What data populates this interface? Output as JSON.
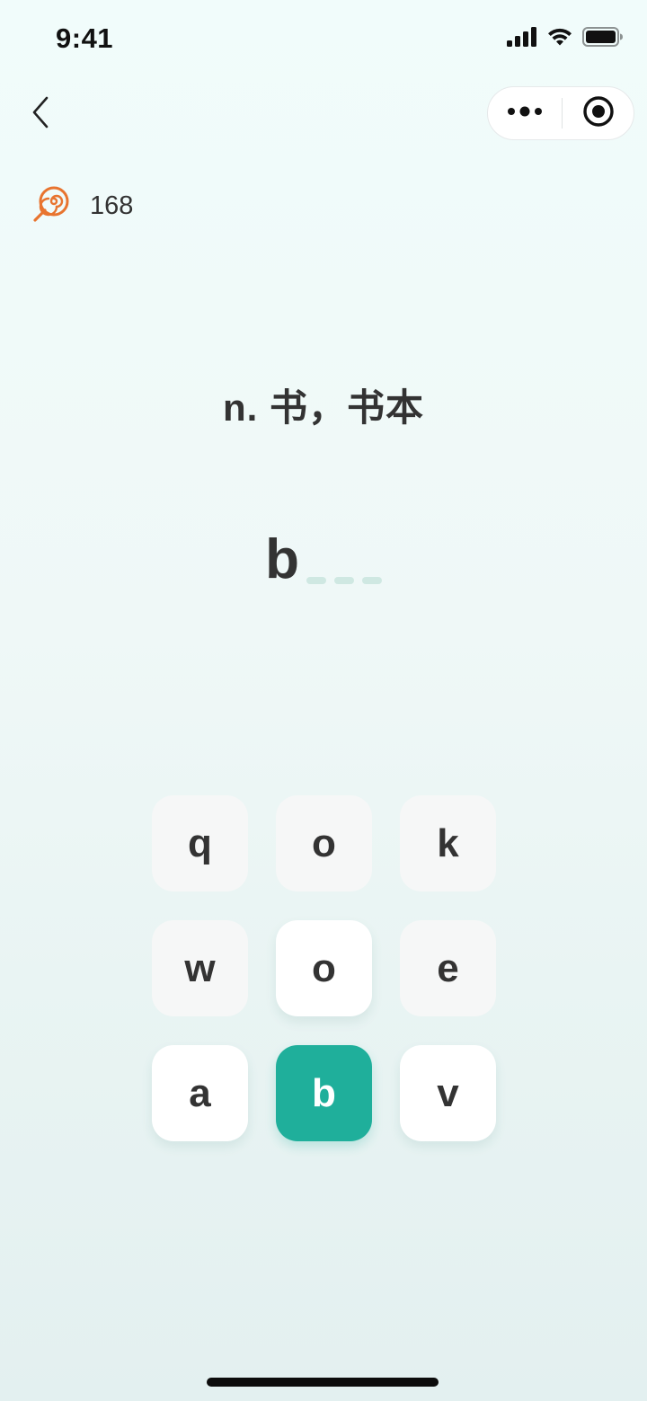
{
  "status_bar": {
    "time": "9:41",
    "signal_icon": "cellular-signal-icon",
    "wifi_icon": "wifi-icon",
    "battery_icon": "battery-icon"
  },
  "nav": {
    "back_icon": "chevron-left-icon",
    "more_icon": "more-dots-icon",
    "close_icon": "target-circle-icon"
  },
  "candy": {
    "icon": "lollipop-icon",
    "count": "168",
    "color": "#e8742f"
  },
  "question": {
    "definition": "n. 书，书本",
    "typed_letters": "b",
    "blank_count": 3
  },
  "keypad": {
    "keys": [
      {
        "letter": "q",
        "state": "used"
      },
      {
        "letter": "o",
        "state": "used"
      },
      {
        "letter": "k",
        "state": "used"
      },
      {
        "letter": "w",
        "state": "used"
      },
      {
        "letter": "o",
        "state": "available"
      },
      {
        "letter": "e",
        "state": "used"
      },
      {
        "letter": "a",
        "state": "available"
      },
      {
        "letter": "b",
        "state": "selected"
      },
      {
        "letter": "v",
        "state": "available"
      }
    ]
  },
  "colors": {
    "accent": "#1faf9b",
    "blank": "#cfe8e2",
    "text": "#333333"
  }
}
